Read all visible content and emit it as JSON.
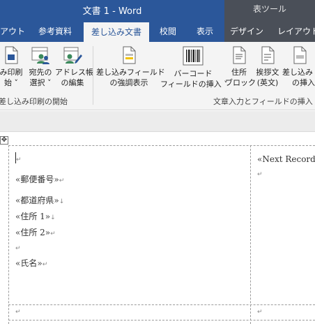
{
  "title_bar": {
    "document_title": "文書 1  -  Word",
    "context_group": "表ツール"
  },
  "tabs": [
    {
      "label": "アウト"
    },
    {
      "label": "参考資料"
    },
    {
      "label": "差し込み文書"
    },
    {
      "label": "校閲"
    },
    {
      "label": "表示"
    },
    {
      "label": "デザイン"
    },
    {
      "label": "レイアウト"
    }
  ],
  "ribbon": {
    "start_group": {
      "buttons": [
        {
          "line1": "み印刷",
          "line2": "始 ˅"
        },
        {
          "line1": "宛先の",
          "line2": "選択 ˅"
        },
        {
          "line1": "アドレス帳",
          "line2": "の編集"
        }
      ],
      "label": "差し込み印刷の開始"
    },
    "write_group": {
      "buttons": [
        {
          "line1": "差し込みフィールド",
          "line2": "の強調表示"
        },
        {
          "line1": "バーコード",
          "line2": "フィールドの挿入 ˅"
        },
        {
          "line1": "住所",
          "line2": "ブロック"
        },
        {
          "line1": "挨拶文",
          "line2": "(英文)"
        },
        {
          "line1": "差し込み",
          "line2": "の挿入"
        }
      ],
      "label": "文章入力とフィールドの挿入"
    }
  },
  "document": {
    "move_handle_glyph": "✥",
    "cell1": {
      "lines": [
        {
          "text": "",
          "mark": "↵"
        },
        {
          "text": "«郵便番号»",
          "mark": "↵"
        },
        {
          "text": "«都道府県»",
          "mark": "↓"
        },
        {
          "text": "«住所 1»",
          "mark": "↓"
        },
        {
          "text": "«住所 2»",
          "mark": "↵"
        },
        {
          "text": "",
          "mark": "↵"
        },
        {
          "text": "«氏名»",
          "mark": "↵"
        }
      ]
    },
    "cell2": {
      "lines": [
        {
          "text": "«Next Record»",
          "mark": ""
        },
        {
          "text": "",
          "mark": "↵"
        }
      ]
    },
    "row2_marks": [
      "↵",
      "↵"
    ]
  }
}
